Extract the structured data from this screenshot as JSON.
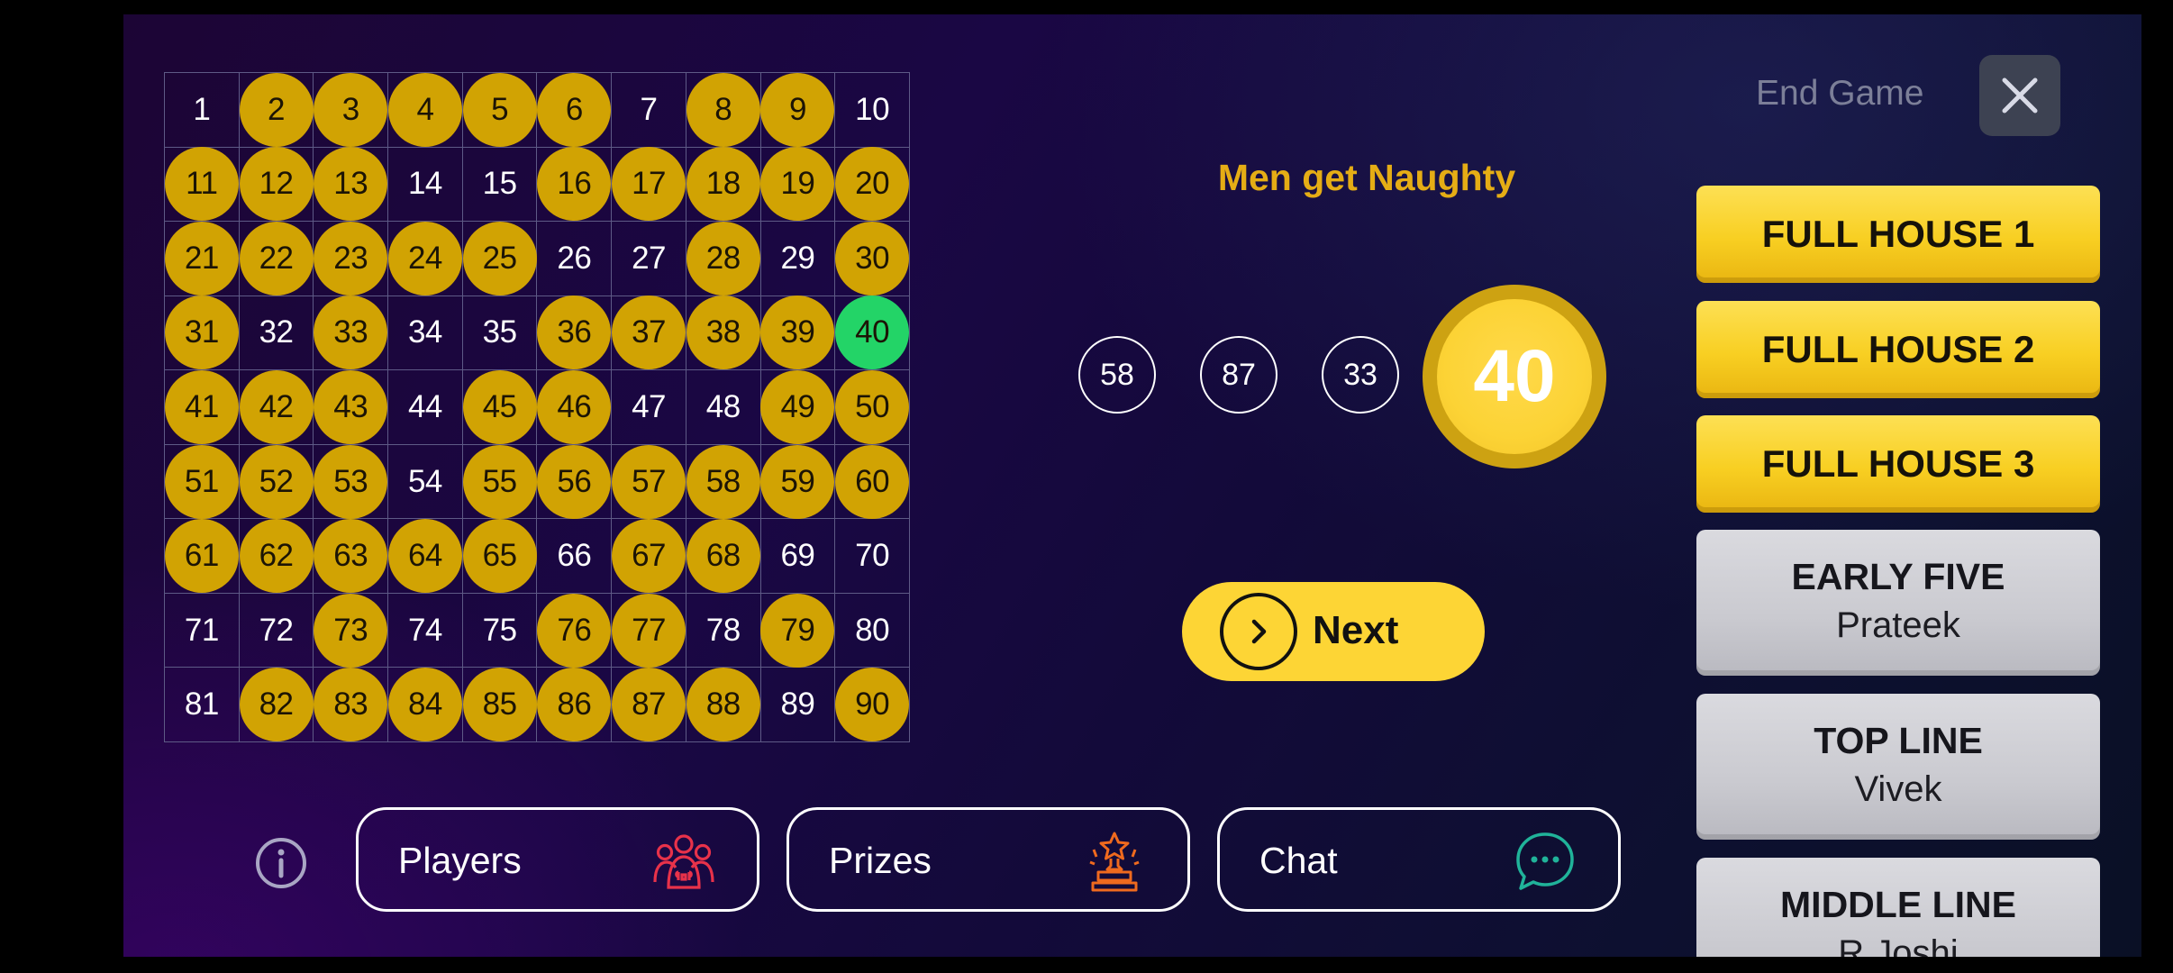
{
  "board": {
    "called": [
      2,
      3,
      4,
      5,
      6,
      8,
      9,
      11,
      12,
      13,
      16,
      17,
      18,
      19,
      20,
      21,
      22,
      23,
      24,
      25,
      28,
      30,
      31,
      33,
      36,
      37,
      38,
      39,
      41,
      42,
      43,
      45,
      46,
      49,
      50,
      51,
      52,
      53,
      55,
      56,
      57,
      58,
      59,
      60,
      61,
      62,
      63,
      64,
      65,
      67,
      68,
      73,
      76,
      77,
      79,
      82,
      83,
      84,
      85,
      86,
      87,
      88,
      90
    ],
    "current": 40
  },
  "header": {
    "end_game_label": "End Game",
    "close_icon": "close-icon"
  },
  "game": {
    "title": "Men get Naughty",
    "history": [
      "58",
      "87",
      "33"
    ],
    "current_number": "40"
  },
  "next_button": {
    "label": "Next",
    "icon": "chevron-right-icon"
  },
  "toolbar": {
    "info_icon": "info-icon",
    "players_label": "Players",
    "players_icon": "players-group-icon",
    "prizes_label": "Prizes",
    "prizes_icon": "trophy-icon",
    "chat_label": "Chat",
    "chat_icon": "chat-bubble-icon"
  },
  "prizes": [
    {
      "name": "FULL HOUSE 1",
      "winner": "",
      "state": "open"
    },
    {
      "name": "FULL HOUSE 2",
      "winner": "",
      "state": "open"
    },
    {
      "name": "FULL HOUSE 3",
      "winner": "",
      "state": "open"
    },
    {
      "name": "EARLY FIVE",
      "winner": "Prateek",
      "state": "claimed"
    },
    {
      "name": "TOP LINE",
      "winner": "Vivek",
      "state": "claimed"
    },
    {
      "name": "MIDDLE LINE",
      "winner": "R Joshi",
      "state": "claimed"
    }
  ],
  "colors": {
    "called_ball": "#d1a303",
    "current_ball_on_board": "#23d467",
    "accent_gold": "#fdd535",
    "title_gold": "#e5ad15",
    "players_icon": "#e8324a",
    "prizes_icon": "#ef6a1e",
    "chat_icon": "#20b39a"
  }
}
